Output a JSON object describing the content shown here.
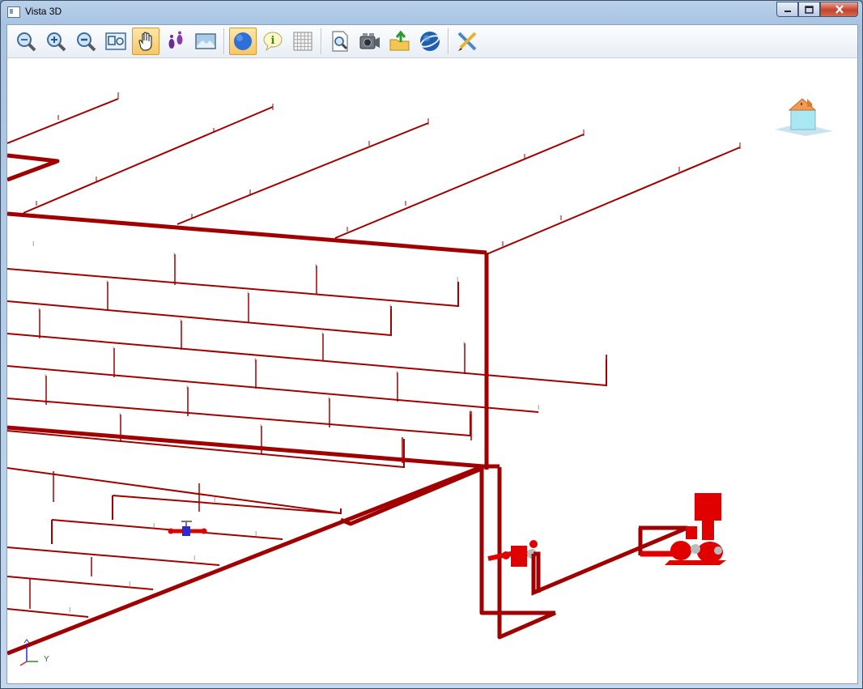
{
  "window": {
    "title": "Vista 3D",
    "controls": {
      "minimize": "_",
      "maximize": "□",
      "close": "✕"
    }
  },
  "toolbar": {
    "buttons": [
      {
        "icon": "zoom-extents-icon",
        "active": false
      },
      {
        "icon": "zoom-in-icon",
        "active": false
      },
      {
        "icon": "zoom-out-icon",
        "active": false
      },
      {
        "icon": "zoom-window-icon",
        "active": false
      },
      {
        "icon": "pan-hand-icon",
        "active": true
      },
      {
        "icon": "walk-footprints-icon",
        "active": false
      },
      {
        "icon": "background-image-icon",
        "active": false
      },
      {
        "icon": "render-sphere-icon",
        "active": true
      },
      {
        "icon": "info-icon",
        "active": false
      },
      {
        "icon": "grid-icon",
        "active": false
      },
      {
        "icon": "preview-icon",
        "active": false
      },
      {
        "icon": "camera-icon",
        "active": false
      },
      {
        "icon": "export-folder-icon",
        "active": false
      },
      {
        "icon": "globe-icon",
        "active": false
      },
      {
        "icon": "edit-tools-icon",
        "active": false
      }
    ]
  },
  "viewport": {
    "axis": {
      "y_label": "Y"
    },
    "colors": {
      "pipe": "#a00000",
      "equipment": "#e00000"
    }
  }
}
